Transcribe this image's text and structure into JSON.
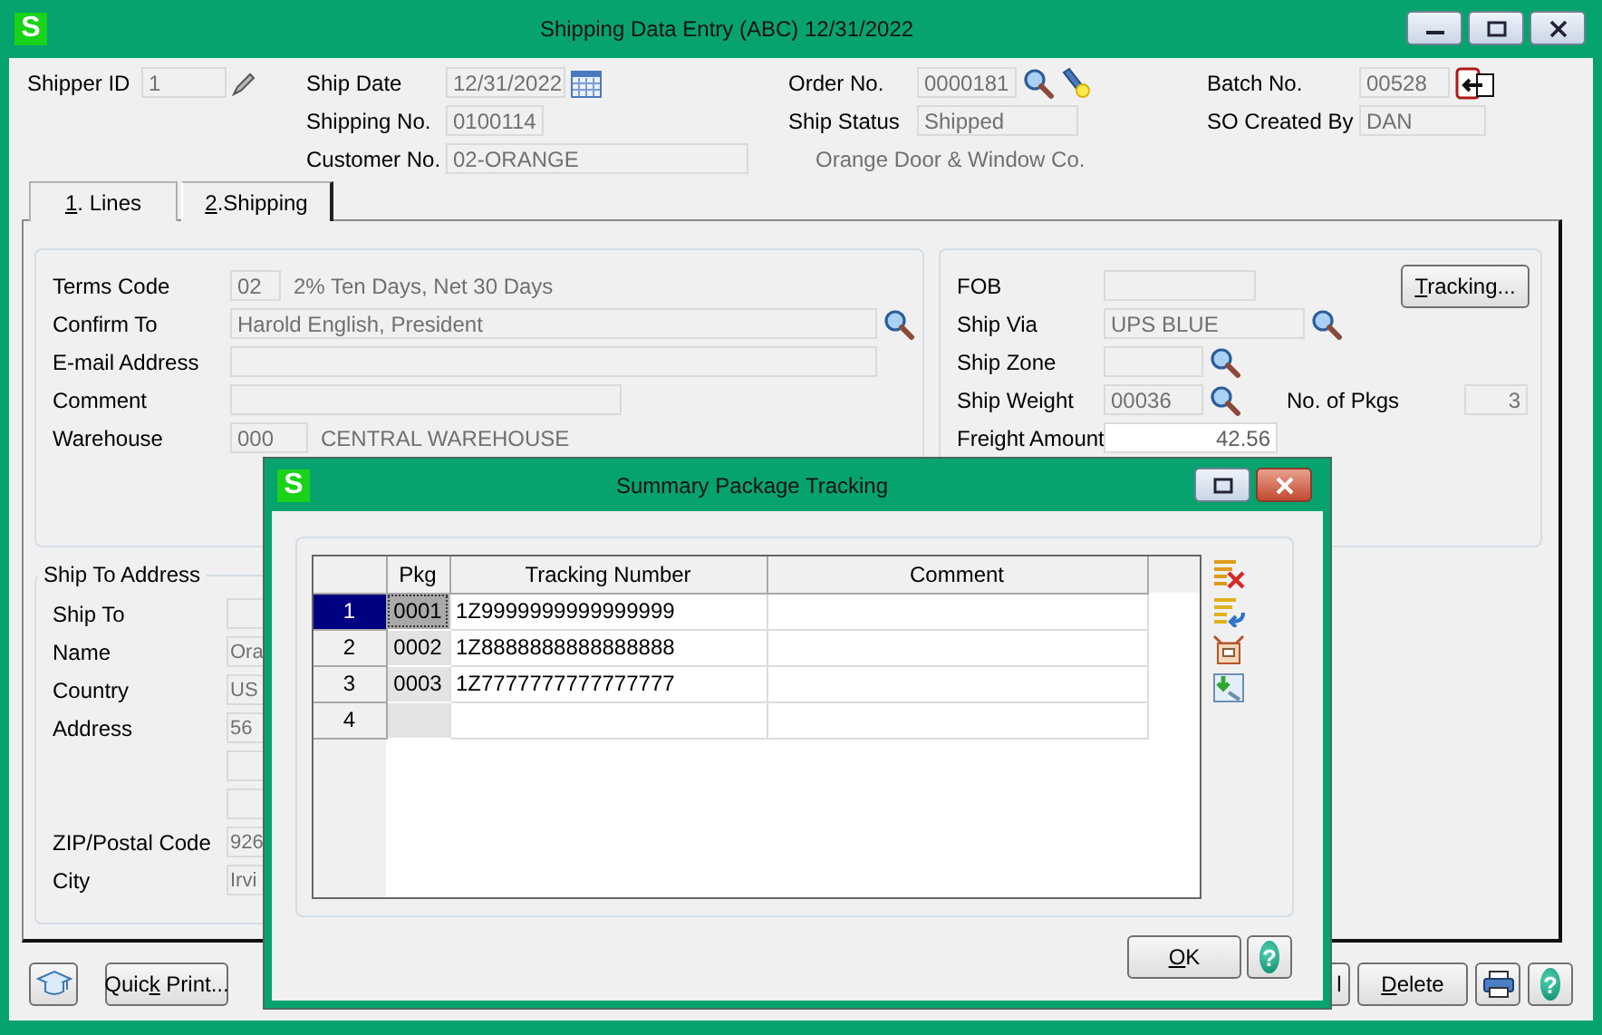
{
  "window": {
    "logo": "S",
    "title": "Shipping Data Entry (ABC) 12/31/2022"
  },
  "header": {
    "columns": [
      [
        {
          "label": "Shipper ID",
          "value": "1"
        }
      ],
      [
        {
          "label": "Ship Date",
          "value": "12/31/2022"
        },
        {
          "label": "Shipping No.",
          "value": "0100114"
        },
        {
          "label": "Customer No.",
          "value": "02-ORANGE"
        }
      ],
      [
        {
          "label": "Order No.",
          "value": "0000181"
        },
        {
          "label": "Ship Status",
          "value": "Shipped"
        }
      ],
      [
        {
          "label": "Batch No.",
          "value": "00528"
        },
        {
          "label": "SO Created By",
          "value": "DAN"
        }
      ]
    ],
    "customer_name": "Orange Door & Window Co."
  },
  "tabs": [
    {
      "key": "1",
      "rest": ". Lines",
      "selected": false
    },
    {
      "key": "2",
      "rest": ".Shipping",
      "selected": true
    }
  ],
  "terms": {
    "rows": [
      {
        "label": "Terms Code",
        "value": "02",
        "description": "2% Ten Days, Net 30 Days"
      },
      {
        "label": "Confirm To",
        "value": "Harold English, President"
      },
      {
        "label": "E-mail Address"
      },
      {
        "label": "Comment"
      },
      {
        "label": "Warehouse",
        "value": "000",
        "description": "CENTRAL WAREHOUSE"
      }
    ]
  },
  "shipping": {
    "tracking_button": {
      "key": "T",
      "rest": "racking..."
    },
    "rows": [
      {
        "label": "FOB",
        "editable": false
      },
      {
        "label": "Ship Via",
        "value": "UPS BLUE",
        "editable": false
      },
      {
        "label": "Ship Zone",
        "editable": false
      },
      {
        "label": "Ship Weight",
        "value": "00036",
        "extra_label": "No. of Pkgs",
        "extra_value": "3",
        "editable": false
      },
      {
        "label": "Freight Amount",
        "value": "42.56",
        "editable": true
      }
    ]
  },
  "ship_to": {
    "title": "Ship To Address",
    "rows": [
      {
        "label": "Ship To"
      },
      {
        "label": "Name",
        "value": "Ora"
      },
      {
        "label": "Country",
        "value": "US"
      },
      {
        "label": "Address",
        "value": "56"
      },
      {
        "kind": "continuation"
      },
      {
        "kind": "continuation"
      },
      {
        "label": "ZIP/Postal Code",
        "value": "926"
      },
      {
        "label": "City",
        "value": "Irvi"
      }
    ]
  },
  "footer": {
    "quick_print": {
      "pre": "Quic",
      "key": "k",
      "rest": " Print..."
    },
    "partial_button": {
      "rest": "l"
    },
    "delete": {
      "key": "D",
      "rest": "elete"
    },
    "help_glyph": "?"
  },
  "dialog": {
    "logo": "S",
    "title": "Summary Package Tracking",
    "columns": [
      "Pkg",
      "Tracking Number",
      "Comment"
    ],
    "rows": [
      {
        "number": "1",
        "pkg": "0001",
        "tracking": "1Z9999999999999999",
        "selected": true
      },
      {
        "number": "2",
        "pkg": "0002",
        "tracking": "1Z8888888888888888",
        "selected": false
      },
      {
        "number": "3",
        "pkg": "0003",
        "tracking": "1Z7777777777777777",
        "selected": false
      },
      {
        "number": "4",
        "selected": false
      }
    ],
    "ok": {
      "key": "O",
      "rest": "K"
    },
    "help_glyph": "?"
  }
}
